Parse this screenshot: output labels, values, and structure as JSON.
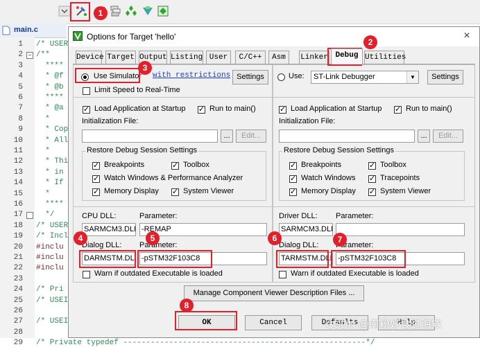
{
  "editor": {
    "file_tab": "main.c",
    "lines": [
      {
        "n": "1",
        "t": "/* USER"
      },
      {
        "n": "2",
        "t": "/**"
      },
      {
        "n": "3",
        "t": "  ****"
      },
      {
        "n": "4",
        "t": "  * @f"
      },
      {
        "n": "5",
        "t": "  * @b"
      },
      {
        "n": "6",
        "t": "  ****"
      },
      {
        "n": "7",
        "t": "  * @a"
      },
      {
        "n": "8",
        "t": "  *"
      },
      {
        "n": "9",
        "t": "  * Cop"
      },
      {
        "n": "10",
        "t": "  * All"
      },
      {
        "n": "11",
        "t": "  *"
      },
      {
        "n": "12",
        "t": "  * Thi"
      },
      {
        "n": "13",
        "t": "  * in"
      },
      {
        "n": "14",
        "t": "  * If"
      },
      {
        "n": "15",
        "t": "  *"
      },
      {
        "n": "16",
        "t": "  ****"
      },
      {
        "n": "17",
        "t": "  */"
      },
      {
        "n": "18",
        "t": "/* USER"
      },
      {
        "n": "19",
        "t": "/* Incl"
      },
      {
        "n": "20",
        "t": "#inclu"
      },
      {
        "n": "21",
        "t": "#inclu"
      },
      {
        "n": "22",
        "t": "#inclu"
      },
      {
        "n": "23",
        "t": ""
      },
      {
        "n": "24",
        "t": "/* Pri"
      },
      {
        "n": "25",
        "t": "/* USEI"
      },
      {
        "n": "26",
        "t": ""
      },
      {
        "n": "27",
        "t": "/* USEI"
      },
      {
        "n": "28",
        "t": ""
      },
      {
        "n": "29",
        "t": "/* Private typedef -----------------------------------------------------*/"
      }
    ]
  },
  "dialog": {
    "title": "Options for Target 'hello'",
    "close": "×",
    "tabs": [
      "Device",
      "Target",
      "Output",
      "Listing",
      "User",
      "C/C++",
      "Asm",
      "Linker",
      "Debug",
      "Utilities"
    ],
    "active_tab": "Debug",
    "left": {
      "use_simulator": "Use Simulator",
      "with_restrictions": "with restrictions",
      "settings": "Settings",
      "limit_speed": "Limit Speed to Real-Time",
      "load_app": "Load Application at Startup",
      "run_to_main": "Run to main()",
      "init_file": "Initialization File:",
      "browse": "...",
      "edit": "Edit...",
      "restore_title": "Restore Debug Session Settings",
      "breakpoints": "Breakpoints",
      "toolbox": "Toolbox",
      "watch_windows": "Watch Windows & Performance Analyzer",
      "memory_display": "Memory Display",
      "system_viewer": "System Viewer",
      "dll_label": "CPU DLL:",
      "dll_param_label": "Parameter:",
      "dll_value": "SARMCM3.DLL",
      "dll_param": "-REMAP",
      "dialog_dll_label": "Dialog DLL:",
      "dialog_param_label": "Parameter:",
      "dialog_dll": "DARMSTM.DLL",
      "dialog_param": "-pSTM32F103C8",
      "warn": "Warn if outdated Executable is loaded"
    },
    "right": {
      "use": "Use:",
      "debugger": "ST-Link Debugger",
      "settings": "Settings",
      "load_app": "Load Application at Startup",
      "run_to_main": "Run to main()",
      "init_file": "Initialization File:",
      "browse": "...",
      "edit": "Edit...",
      "restore_title": "Restore Debug Session Settings",
      "breakpoints": "Breakpoints",
      "toolbox": "Toolbox",
      "watch_windows": "Watch Windows",
      "tracepoints": "Tracepoints",
      "memory_display": "Memory Display",
      "system_viewer": "System Viewer",
      "dll_label": "Driver DLL:",
      "dll_param_label": "Parameter:",
      "dll_value": "SARMCM3.DLL",
      "dll_param": "",
      "dialog_dll_label": "Dialog DLL:",
      "dialog_param_label": "Parameter:",
      "dialog_dll": "TARMSTM.DLL",
      "dialog_param": "-pSTM32F103C8",
      "warn": "Warn if outdated Executable is loaded"
    },
    "manage_btn": "Manage Component Viewer Description Files ...",
    "ok": "OK",
    "cancel": "Cancel",
    "defaults": "Defaults",
    "help": "Help"
  },
  "annotations": [
    "1",
    "2",
    "3",
    "4",
    "5",
    "6",
    "7",
    "8"
  ],
  "watermark": "CSDN @南粉好食过海欸",
  "colors": {
    "annotation": "#e0202a",
    "link": "#1a3fcf",
    "comment": "#2e8b57"
  }
}
